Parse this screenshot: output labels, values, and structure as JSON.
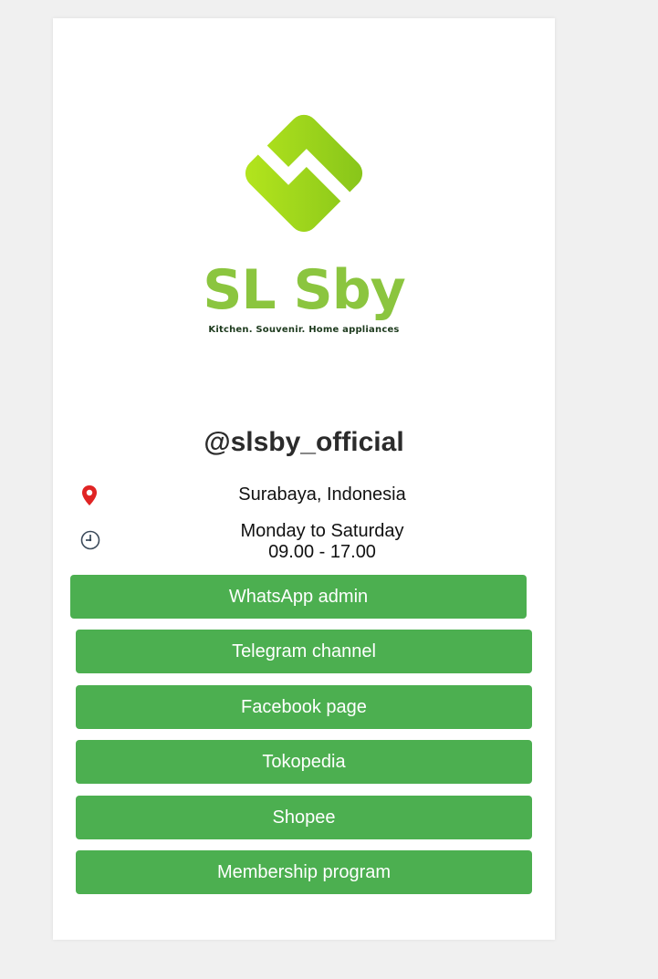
{
  "brand": {
    "name": "SL Sby",
    "tagline": "Kitchen. Souvenir. Home appliances",
    "color": "#8bc53f",
    "color_light": "#a6d928"
  },
  "profile": {
    "handle": "@slsby_official"
  },
  "info": {
    "location": "Surabaya, Indonesia",
    "hours_days": "Monday to Saturday",
    "hours_time": "09.00 - 17.00",
    "location_icon": "map-pin-icon",
    "hours_icon": "clock-icon"
  },
  "links": [
    {
      "label": "WhatsApp admin"
    },
    {
      "label": "Telegram channel"
    },
    {
      "label": "Facebook page"
    },
    {
      "label": "Tokopedia"
    },
    {
      "label": "Shopee"
    },
    {
      "label": "Membership program"
    }
  ],
  "colors": {
    "button": "#4caf50",
    "button_text": "#ffffff",
    "background": "#f0f0f0",
    "card": "#ffffff"
  }
}
